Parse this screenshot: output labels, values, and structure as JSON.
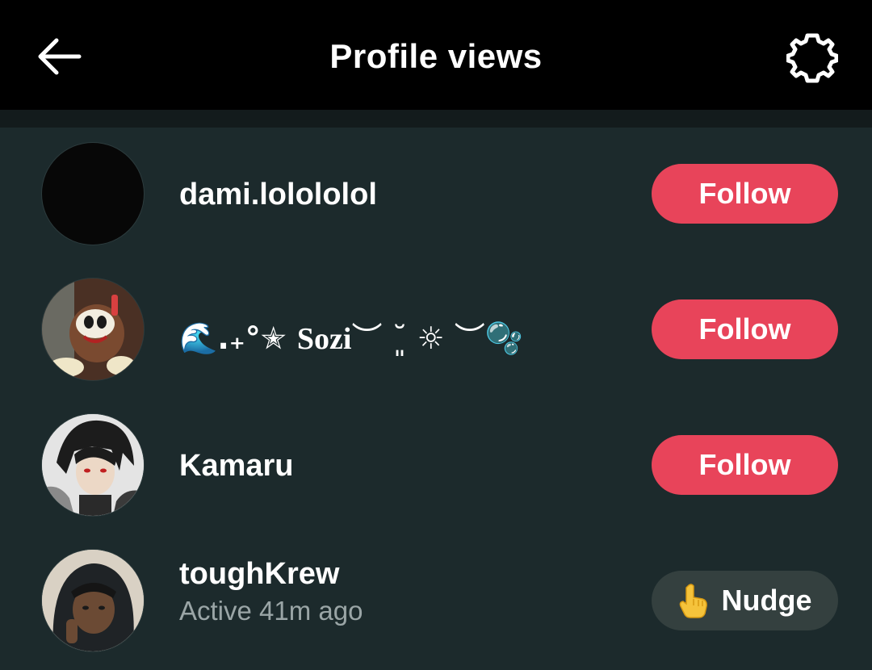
{
  "header": {
    "title": "Profile views",
    "back_icon": "arrow-left-icon",
    "settings_icon": "gear-icon"
  },
  "colors": {
    "background": "#1c2a2c",
    "header": "#000000",
    "follow_button": "#e8445a",
    "nudge_button": "#34403f",
    "secondary_text": "#9aa5a6"
  },
  "viewers": [
    {
      "name": "dami.lolololol",
      "action": "Follow"
    },
    {
      "name_parts": {
        "lead": "🌊.₊°✭ ",
        "main": "Sozi",
        "trail": "︶ ˘͈ ☼ ︶🫧"
      },
      "action": "Follow"
    },
    {
      "name": "Kamaru",
      "action": "Follow"
    },
    {
      "name": "toughKrew",
      "status": "Active 41m ago",
      "action": "Nudge",
      "action_icon": "pointing-hand-icon"
    }
  ]
}
